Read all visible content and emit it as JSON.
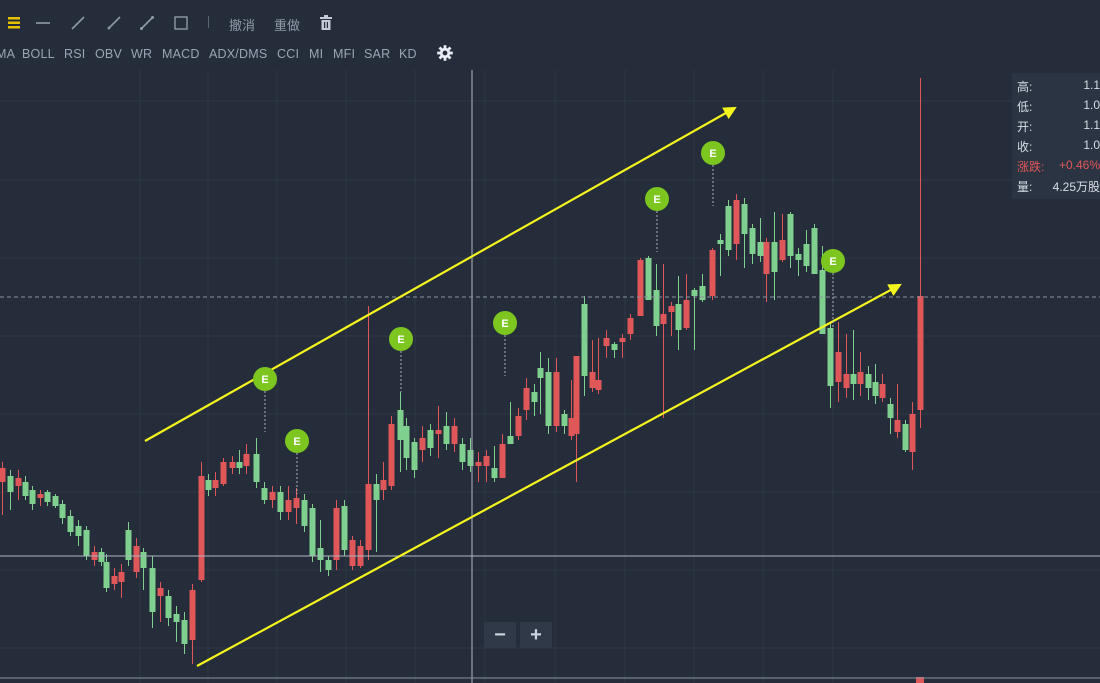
{
  "toolbar": {
    "tools": [
      {
        "name": "drawing-menu-icon"
      },
      {
        "name": "horizontal-line-icon"
      },
      {
        "name": "trend-line-icon"
      },
      {
        "name": "ray-line-icon"
      },
      {
        "name": "segment-line-icon"
      },
      {
        "name": "rectangle-icon"
      }
    ],
    "undo_label": "撤消",
    "redo_label": "重做",
    "delete_icon": "trash-icon"
  },
  "indicators": [
    "MA",
    "BOLL",
    "RSI",
    "OBV",
    "WR",
    "MACD",
    "ADX/DMS",
    "CCI",
    "MI",
    "MFI",
    "SAR",
    "KD"
  ],
  "settings_icon": "gear-icon",
  "info_panel": {
    "high_label": "高:",
    "high_value": "1.1",
    "low_label": "低:",
    "low_value": "1.0",
    "open_label": "开:",
    "open_value": "1.1",
    "close_label": "收:",
    "close_value": "1.0",
    "change_label": "涨跌:",
    "change_value": "+0.46%",
    "volume_label": "量:",
    "volume_value": "4.25万股"
  },
  "zoom": {
    "minus_label": "−",
    "plus_label": "+"
  },
  "event_marker_label": "E",
  "colors": {
    "background": "#252d3a",
    "up": "#e0575a",
    "down": "#7fd08f",
    "trendline": "#f5f51e",
    "event": "#7cc61f"
  },
  "chart_data": {
    "type": "candlestick",
    "annotations": [
      "upward channel drawn with two yellow trend lines",
      "event markers labelled E"
    ]
  }
}
